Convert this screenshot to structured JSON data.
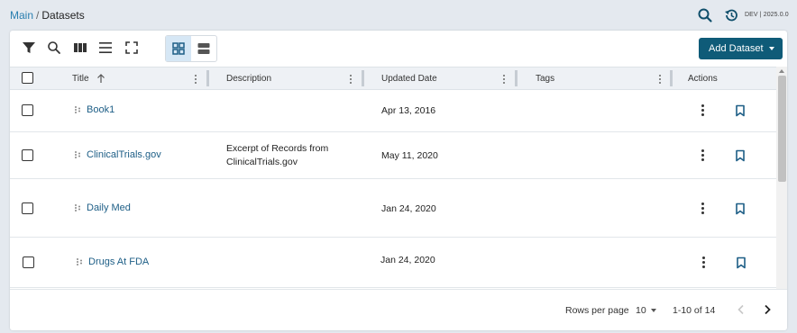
{
  "breadcrumb": {
    "parent": "Main",
    "separator": "/",
    "current": "Datasets"
  },
  "header": {
    "env_label": "DEV | 2025.0.0",
    "icons": [
      "search-icon",
      "history-icon"
    ]
  },
  "toolbar": {
    "icons": [
      "filter-icon",
      "search-icon",
      "columns-icon",
      "density-icon",
      "fullscreen-icon"
    ],
    "view_modes": [
      "grid-view",
      "list-view"
    ],
    "active_view": "grid-view",
    "add_button_label": "Add Dataset"
  },
  "table": {
    "columns": [
      "Title",
      "Description",
      "Updated Date",
      "Tags",
      "Actions"
    ],
    "sorted_column": "Title",
    "sort_direction": "ascending",
    "rows": [
      {
        "title": "Book1",
        "description": "",
        "updated": "Apr 13, 2016",
        "tags": ""
      },
      {
        "title": "ClinicalTrials.gov",
        "description_line1": "Excerpt of Records from",
        "description_line2": "ClinicalTrials.gov",
        "updated": "May 11, 2020",
        "tags": ""
      },
      {
        "title": "Daily Med",
        "description": "",
        "updated": "Jan 24, 2020",
        "tags": ""
      },
      {
        "title": "Drugs At FDA",
        "description": "",
        "updated": "Jan 24, 2020",
        "tags": ""
      }
    ]
  },
  "pagination": {
    "rows_per_page_label": "Rows per page",
    "rows_per_page": "10",
    "range": "1-10 of 14"
  },
  "colors": {
    "accent": "#0f5b78",
    "link": "#1d5e86",
    "breadcrumb_link": "#2a7fb0",
    "header_bg": "#eef1f5",
    "active_toggle": "#d6e7f5"
  }
}
